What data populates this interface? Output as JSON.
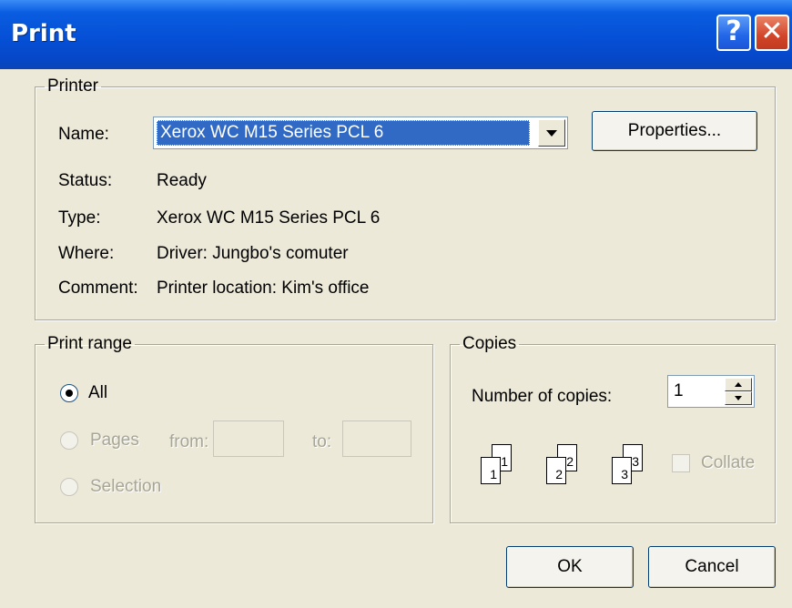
{
  "window": {
    "title": "Print"
  },
  "printer": {
    "group_label": "Printer",
    "name_label": "Name:",
    "name_value": "Xerox WC M15 Series PCL 6",
    "properties_label": "Properties...",
    "status_label": "Status:",
    "status_value": "Ready",
    "type_label": "Type:",
    "type_value": "Xerox WC M15 Series PCL 6",
    "where_label": "Where:",
    "where_value": "Driver: Jungbo's comuter",
    "comment_label": "Comment:",
    "comment_value": "Printer location: Kim's office"
  },
  "print_range": {
    "group_label": "Print range",
    "all_label": "All",
    "pages_label": "Pages",
    "from_label": "from:",
    "to_label": "to:",
    "selection_label": "Selection",
    "selected": "All"
  },
  "copies": {
    "group_label": "Copies",
    "number_label": "Number of copies:",
    "number_value": "1",
    "collate_label": "Collate",
    "page_labels": [
      "1",
      "1",
      "2",
      "2",
      "3",
      "3"
    ]
  },
  "buttons": {
    "ok_label": "OK",
    "cancel_label": "Cancel"
  },
  "icons": {
    "help": "help-icon",
    "close": "close-icon"
  }
}
